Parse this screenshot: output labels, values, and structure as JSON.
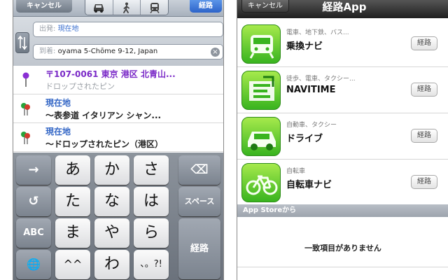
{
  "left": {
    "toolbar": {
      "cancel_label": "キャンセル",
      "route_label": "経路",
      "transport_modes": [
        "car-icon",
        "walk-icon",
        "transit-icon"
      ]
    },
    "start_field": {
      "label": "出発:",
      "value": "現在地"
    },
    "end_field": {
      "label": "到着:",
      "value": "oyama 5-Chōme 9-12, Japan"
    },
    "suggestions": [
      {
        "line1": "〒107-0061 東京 港区 北青山...",
        "line2": "ドロップされたピン"
      },
      {
        "line1": "現在地",
        "line2": "〜表参道 イタリアン シャン..."
      },
      {
        "line1": "現在地",
        "line2": "〜ドロップされたピン（港区）"
      }
    ],
    "keyboard": {
      "arrow_right": "→",
      "undo": "↺",
      "abc": "ABC",
      "globe": "🌐",
      "row1": [
        "あ",
        "か",
        "さ"
      ],
      "row2": [
        "た",
        "な",
        "は"
      ],
      "row3": [
        "ま",
        "や",
        "ら"
      ],
      "row4": [
        "^^",
        "わ",
        "、。?!"
      ],
      "backspace": "⌫",
      "space": "スペース",
      "route": "経路"
    }
  },
  "right": {
    "nav": {
      "cancel_label": "キャンセル",
      "title": "経路App"
    },
    "apps": [
      {
        "category": "電車、地下鉄、バス...",
        "name": "乗換ナビ",
        "route_label": "経路",
        "icon": "train-icon"
      },
      {
        "category": "徒歩、電車、タクシー...",
        "name": "NAVITIME",
        "route_label": "経路",
        "icon": "navitime-icon"
      },
      {
        "category": "自動車、タクシー",
        "name": "ドライブ",
        "route_label": "経路",
        "icon": "car-icon"
      },
      {
        "category": "自転車",
        "name": "自転車ナビ",
        "route_label": "経路",
        "icon": "bicycle-icon"
      }
    ],
    "section_header": "App Storeから",
    "empty_message": "一致項目がありません"
  },
  "colors": {
    "route_button_blue": "#2c63c9",
    "app_icon_green": "#39b41f",
    "address_purple": "#7a29c7",
    "link_blue": "#3467c6"
  }
}
